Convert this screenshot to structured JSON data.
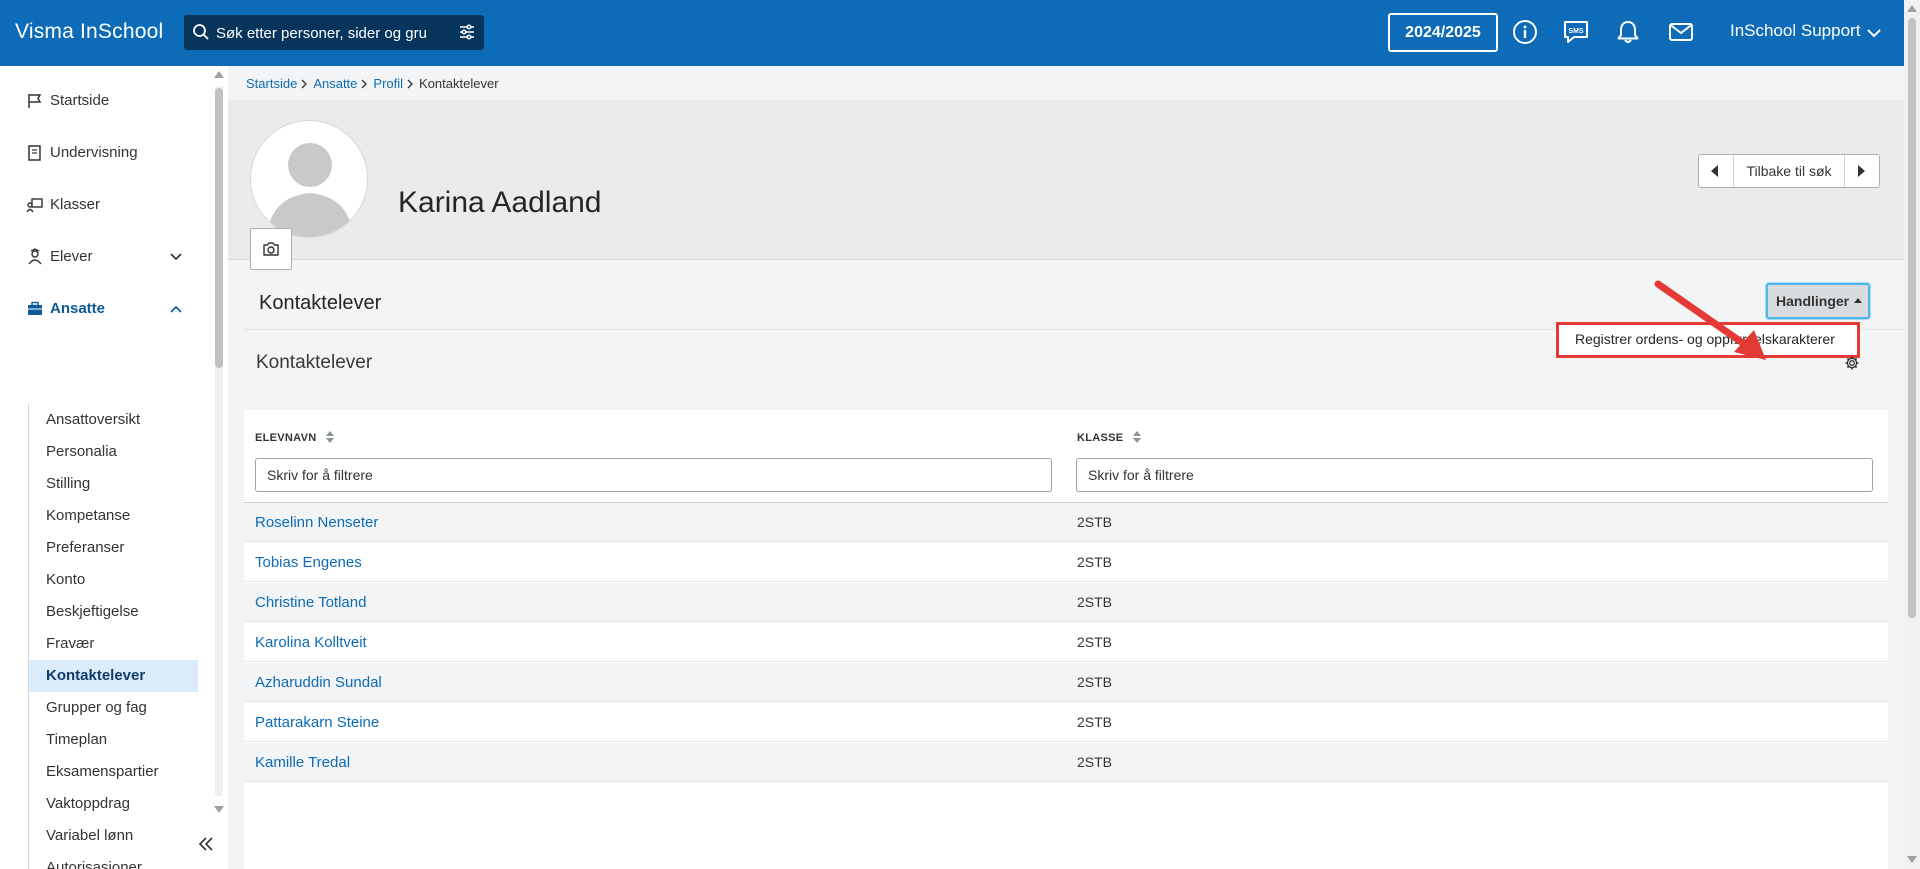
{
  "app": {
    "title": "Visma InSchool"
  },
  "search": {
    "placeholder": "Søk etter personer, sider og grupper"
  },
  "header": {
    "school_year": "2024/2025",
    "user_name": "InSchool Support"
  },
  "sidebar": {
    "main_items": [
      {
        "label": "Startside",
        "icon": "flag-icon"
      },
      {
        "label": "Undervisning",
        "icon": "book-icon"
      },
      {
        "label": "Klasser",
        "icon": "classroom-icon"
      },
      {
        "label": "Elever",
        "icon": "students-icon"
      },
      {
        "label": "Ansatte",
        "icon": "briefcase-icon"
      }
    ],
    "sub_items": [
      "Ansattoversikt",
      "Personalia",
      "Stilling",
      "Kompetanse",
      "Preferanser",
      "Konto",
      "Beskjeftigelse",
      "Fravær",
      "Kontaktelever",
      "Grupper og fag",
      "Timeplan",
      "Eksamenspartier",
      "Vaktoppdrag",
      "Variabel lønn",
      "Autorisasjoner"
    ],
    "active_sub_item": "Kontaktelever"
  },
  "breadcrumb": {
    "items": [
      "Startside",
      "Ansatte",
      "Profil"
    ],
    "current": "Kontaktelever"
  },
  "profile": {
    "name": "Karina Aadland"
  },
  "navigation": {
    "back_label": "Tilbake til søk"
  },
  "section": {
    "title": "Kontaktelever",
    "actions_label": "Handlinger",
    "dropdown_item": "Registrer ordens- og oppførselskarakterer",
    "subtitle": "Kontaktelever"
  },
  "table": {
    "columns": [
      "ELEVNAVN",
      "KLASSE"
    ],
    "filter_placeholder": "Skriv for å filtrere",
    "rows": [
      {
        "name": "Roselinn Nenseter",
        "class": "2STB"
      },
      {
        "name": "Tobias Engenes",
        "class": "2STB"
      },
      {
        "name": "Christine Totland",
        "class": "2STB"
      },
      {
        "name": "Karolina Kolltveit",
        "class": "2STB"
      },
      {
        "name": "Azharuddin Sundal",
        "class": "2STB"
      },
      {
        "name": "Pattarakarn Steine",
        "class": "2STB"
      },
      {
        "name": "Kamille Tredal",
        "class": "2STB"
      }
    ]
  },
  "colors": {
    "brand": "#0d6bb7",
    "search_bg": "#06345b",
    "active_nav_bg": "#dcebfa",
    "highlight_red": "#e53935",
    "focus_blue": "#50b5e8"
  }
}
